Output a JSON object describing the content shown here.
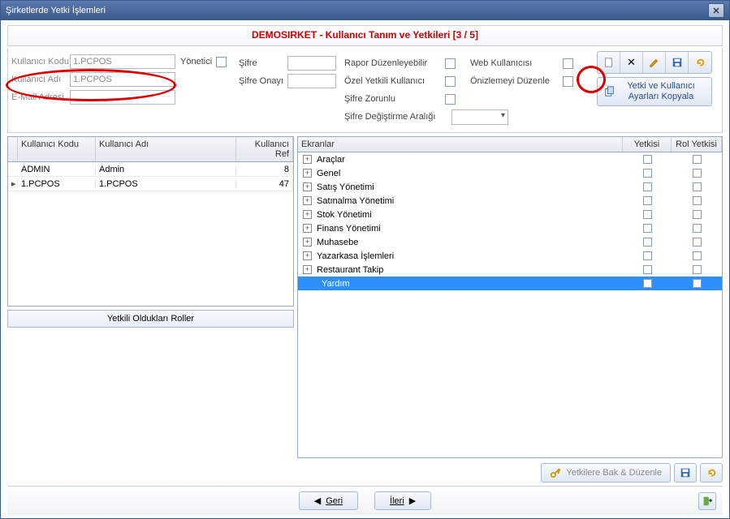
{
  "window": {
    "title": "Şirketlerde Yetki İşlemleri"
  },
  "header": {
    "text": "DEMOSIRKET - Kullanıcı Tanım ve Yetkileri  [3 / 5]"
  },
  "form": {
    "kullanici_kodu_label": "Kullanıcı Kodu",
    "kullanici_kodu_value": "1.PCPOS",
    "kullanici_adi_label": "Kullanıcı Adı",
    "kullanici_adi_value": "1.PCPOS",
    "email_label": "E-Mail Adresi",
    "email_value": "",
    "yonetici_label": "Yönetici",
    "sifre_label": "Şifre",
    "sifre_onay_label": "Şifre Onayı",
    "rapor_label": "Rapor Düzenleyebilir",
    "ozel_label": "Özel Yetkili Kullanıcı",
    "sifre_zorunlu_label": "Şifre Zorunlu",
    "sifre_aralik_label": "Şifre Değiştirme Aralığı",
    "web_label": "Web Kullanıcısı",
    "onizleme_label": "Önizlemeyi Düzenle",
    "copy_btn": "Yetki ve Kullanıcı Ayarları Kopyala"
  },
  "users_grid": {
    "col1": "Kullanıcı Kodu",
    "col2": "Kullanıcı Adı",
    "col3": "Kullanıcı Ref",
    "rows": [
      {
        "kod": "ADMIN",
        "ad": "Admin",
        "ref": "8"
      },
      {
        "kod": "1.PCPOS",
        "ad": "1.PCPOS",
        "ref": "47"
      }
    ]
  },
  "roles_btn": "Yetkili Oldukları Roller",
  "tree": {
    "col1": "Ekranlar",
    "col2": "Yetkisi",
    "col3": "Rol Yetkisi",
    "items": [
      "Araçlar",
      "Genel",
      "Satış Yönetimi",
      "Satınalma Yönetimi",
      "Stok Yönetimi",
      "Finans Yönetimi",
      "Muhasebe",
      "Yazarkasa İşlemleri",
      "Restaurant Takip",
      "Yardım"
    ]
  },
  "buttons": {
    "yetkilere_bak": "Yetkilere Bak & Düzenle",
    "geri": "Geri",
    "ileri": "İleri"
  }
}
